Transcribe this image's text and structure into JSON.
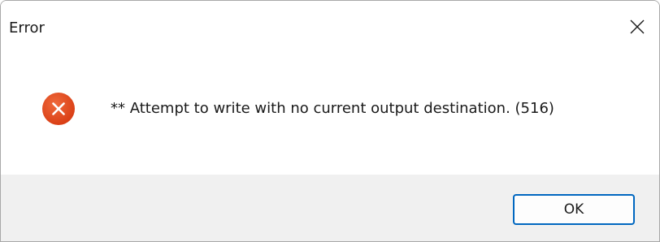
{
  "window": {
    "title": "Error"
  },
  "dialog": {
    "icon": "error-icon",
    "message": "** Attempt to write with no current output destination. (516)"
  },
  "buttons": {
    "ok_label": "OK"
  },
  "colors": {
    "error_icon": "#e0481f",
    "button_border": "#0067c0",
    "footer_background": "#f0f0f0"
  }
}
